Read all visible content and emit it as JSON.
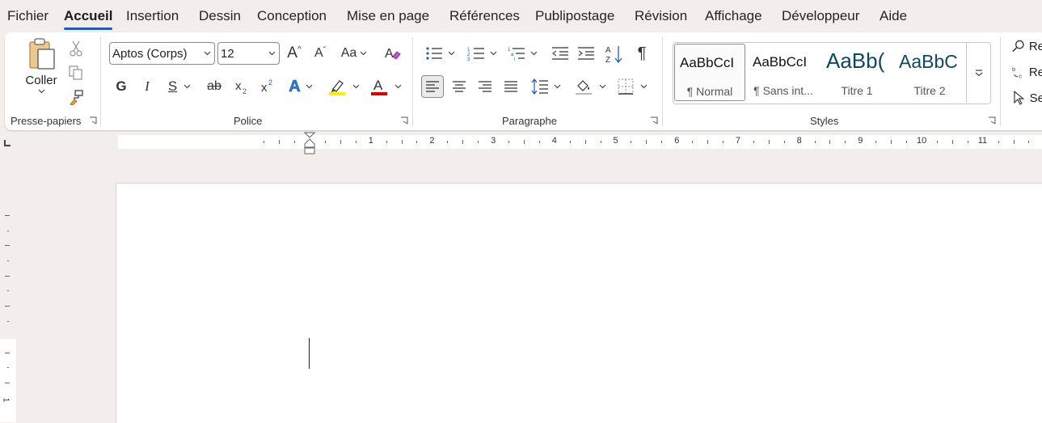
{
  "menu": {
    "tabs": [
      {
        "label": "Fichier"
      },
      {
        "label": "Accueil",
        "active": true
      },
      {
        "label": "Insertion"
      },
      {
        "label": "Dessin"
      },
      {
        "label": "Conception"
      },
      {
        "label": "Mise en page"
      },
      {
        "label": "Références"
      },
      {
        "label": "Publipostage"
      },
      {
        "label": "Révision"
      },
      {
        "label": "Affichage"
      },
      {
        "label": "Développeur"
      },
      {
        "label": "Aide"
      }
    ]
  },
  "ribbon": {
    "clipboard": {
      "label": "Presse-papiers",
      "paste_label": "Coller"
    },
    "font": {
      "label": "Police",
      "font_name": "Aptos (Corps)",
      "font_size": "12",
      "bold_glyph": "G",
      "italic_glyph": "I",
      "underline_glyph": "S",
      "strike_glyph": "ab",
      "case_glyph": "Aa",
      "grow_glyph": "A",
      "shrink_glyph": "A",
      "effects_glyph": "A",
      "font_color_glyph": "A",
      "highlight_color": "#ffff00",
      "font_color": "#e00000"
    },
    "paragraph": {
      "label": "Paragraphe",
      "pilcrow": "¶"
    },
    "styles": {
      "label": "Styles",
      "items": [
        {
          "preview": "AaBbCcI",
          "name": "¶ Normal"
        },
        {
          "preview": "AaBbCcI",
          "name": "¶ Sans int..."
        },
        {
          "preview": "AaBb(",
          "name": "Titre 1"
        },
        {
          "preview": "AaBbC",
          "name": "Titre 2"
        }
      ]
    },
    "editing": {
      "find_label": "Re",
      "replace_label": "Re",
      "select_label": "Se"
    }
  },
  "ruler": {
    "numbers": [
      "1",
      "2",
      "3",
      "4",
      "5",
      "6",
      "7",
      "8",
      "9",
      "10",
      "11",
      "1"
    ]
  },
  "vruler": {
    "number": "1"
  },
  "colors": {
    "accent": "#1e5bbd",
    "heading": "#0f4761"
  }
}
